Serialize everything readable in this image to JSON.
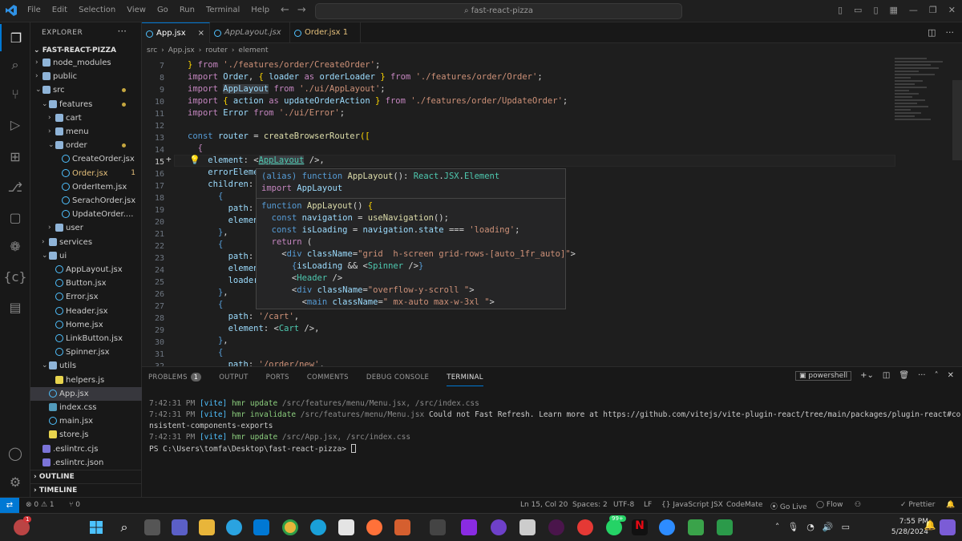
{
  "titlebar": {
    "menu": [
      "File",
      "Edit",
      "Selection",
      "View",
      "Go",
      "Run",
      "Terminal",
      "Help"
    ],
    "search": "fast-react-pizza"
  },
  "sidebar": {
    "header": "EXPLORER",
    "project": "FAST-REACT-PIZZA",
    "tree": [
      {
        "label": "node_modules",
        "depth": 1,
        "kind": "folder",
        "open": false
      },
      {
        "label": "public",
        "depth": 1,
        "kind": "folder",
        "open": false
      },
      {
        "label": "src",
        "depth": 1,
        "kind": "folder",
        "open": true,
        "status": "dot"
      },
      {
        "label": "features",
        "depth": 2,
        "kind": "folder",
        "open": true,
        "status": "dot"
      },
      {
        "label": "cart",
        "depth": 3,
        "kind": "folder",
        "open": false
      },
      {
        "label": "menu",
        "depth": 3,
        "kind": "folder",
        "open": false
      },
      {
        "label": "order",
        "depth": 3,
        "kind": "folder",
        "open": true,
        "status": "dot"
      },
      {
        "label": "CreateOrder.jsx",
        "depth": 4,
        "kind": "file"
      },
      {
        "label": "Order.jsx",
        "depth": 4,
        "kind": "file",
        "status": "warn",
        "badge": "1"
      },
      {
        "label": "OrderItem.jsx",
        "depth": 4,
        "kind": "file"
      },
      {
        "label": "SerachOrder.jsx",
        "depth": 4,
        "kind": "file"
      },
      {
        "label": "UpdateOrder....",
        "depth": 4,
        "kind": "file"
      },
      {
        "label": "user",
        "depth": 3,
        "kind": "folder",
        "open": false
      },
      {
        "label": "services",
        "depth": 2,
        "kind": "folder",
        "open": false
      },
      {
        "label": "ui",
        "depth": 2,
        "kind": "folder",
        "open": true
      },
      {
        "label": "AppLayout.jsx",
        "depth": 3,
        "kind": "file"
      },
      {
        "label": "Button.jsx",
        "depth": 3,
        "kind": "file"
      },
      {
        "label": "Error.jsx",
        "depth": 3,
        "kind": "file"
      },
      {
        "label": "Header.jsx",
        "depth": 3,
        "kind": "file"
      },
      {
        "label": "Home.jsx",
        "depth": 3,
        "kind": "file"
      },
      {
        "label": "LinkButton.jsx",
        "depth": 3,
        "kind": "file"
      },
      {
        "label": "Spinner.jsx",
        "depth": 3,
        "kind": "file"
      },
      {
        "label": "utils",
        "depth": 2,
        "kind": "folder",
        "open": true
      },
      {
        "label": "helpers.js",
        "depth": 3,
        "kind": "jsfile"
      },
      {
        "label": "App.jsx",
        "depth": 2,
        "kind": "file",
        "selected": true
      },
      {
        "label": "index.css",
        "depth": 2,
        "kind": "css"
      },
      {
        "label": "main.jsx",
        "depth": 2,
        "kind": "file"
      },
      {
        "label": "store.js",
        "depth": 2,
        "kind": "jsfile"
      },
      {
        "label": ".eslintrc.cjs",
        "depth": 1,
        "kind": "eslint"
      },
      {
        "label": ".eslintrc.json",
        "depth": 1,
        "kind": "json"
      }
    ],
    "outline": "OUTLINE",
    "timeline": "TIMELINE"
  },
  "tabs": [
    {
      "label": "App.jsx",
      "active": true,
      "close": "×"
    },
    {
      "label": "AppLayout.jsx",
      "active": false,
      "italic": true
    },
    {
      "label": "Order.jsx 1",
      "active": false,
      "warn": true
    }
  ],
  "breadcrumb": [
    "src",
    "›",
    "App.jsx",
    "›",
    "router",
    "›",
    "element"
  ],
  "editor": {
    "line_numbers": [
      "7",
      "8",
      "9",
      "10",
      "11",
      "12",
      "13",
      "14",
      "15",
      "16",
      "17",
      "18",
      "19",
      "20",
      "21",
      "22",
      "23",
      "24",
      "25",
      "26",
      "27",
      "28",
      "29",
      "30",
      "31",
      "32"
    ],
    "current_line": "15"
  },
  "hover": {
    "signature": "(alias) function AppLayout(): React.JSX.Element",
    "import": "import AppLayout"
  },
  "panel": {
    "tabs": [
      "PROBLEMS",
      "OUTPUT",
      "PORTS",
      "COMMENTS",
      "DEBUG CONSOLE",
      "TERMINAL"
    ],
    "problems_count": "1",
    "shell": "powershell",
    "lines": [
      {
        "time": "7:42:31 PM",
        "tag": "[vite]",
        "msg": " hmr update ",
        "path": "/src/features/menu/Menu.jsx, /src/index.css"
      },
      {
        "time": "7:42:31 PM",
        "tag": "[vite]",
        "msg": " hmr invalidate ",
        "path": "/src/features/menu/Menu.jsx",
        "tail": " Could not Fast Refresh. Learn more at https://github.com/vitejs/vite-plugin-react/tree/main/packages/plugin-react#co"
      },
      {
        "plain": "nsistent-components-exports"
      },
      {
        "time": "7:42:31 PM",
        "tag": "[vite]",
        "msg": " hmr update ",
        "path": "/src/App.jsx, /src/index.css"
      },
      {
        "plain": "PS C:\\Users\\tomfa\\Desktop\\fast-react-pizza> "
      }
    ]
  },
  "status": {
    "problems": "⊗ 0 ⚠ 1",
    "ports": "⑂ 0",
    "position": "Ln 15, Col 20",
    "spaces": "Spaces: 2",
    "encoding": "UTF-8",
    "eol": "LF",
    "language": "{} JavaScript JSX",
    "codemate": "CodeMate",
    "golive": "⦿ Go Live",
    "flow": "◯ Flow",
    "prettier": "✓ Prettier"
  },
  "taskbar": {
    "time": "7:55 PM",
    "date": "5/28/2024",
    "badge": "99+",
    "notif": "1"
  },
  "colors": {
    "accent": "#0078d4",
    "editor_bg": "#1e1e1e",
    "sidebar_bg": "#181818"
  }
}
